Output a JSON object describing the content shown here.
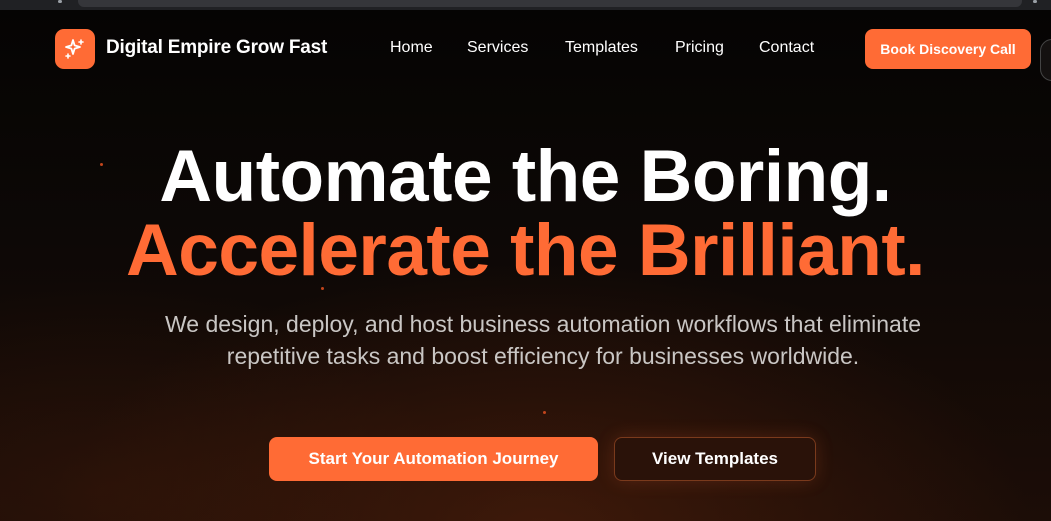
{
  "brand": {
    "name": "Digital Empire Grow Fast",
    "logo_icon": "sparkles-icon",
    "accent_color": "#ff6b35"
  },
  "nav": {
    "links": [
      {
        "label": "Home"
      },
      {
        "label": "Services"
      },
      {
        "label": "Templates"
      },
      {
        "label": "Pricing"
      },
      {
        "label": "Contact"
      }
    ],
    "cta_label": "Book Discovery Call"
  },
  "hero": {
    "headline_line1": "Automate the Boring.",
    "headline_line2": "Accelerate the Brilliant.",
    "subtitle": "We design, deploy, and host business automation workflows that eliminate repetitive tasks and boost efficiency for businesses worldwide.",
    "primary_button": "Start Your Automation Journey",
    "secondary_button": "View Templates"
  },
  "colors": {
    "background": "#0b0807",
    "headline_accent": "#ff6b35",
    "subtitle_text": "#c9c6c4"
  }
}
